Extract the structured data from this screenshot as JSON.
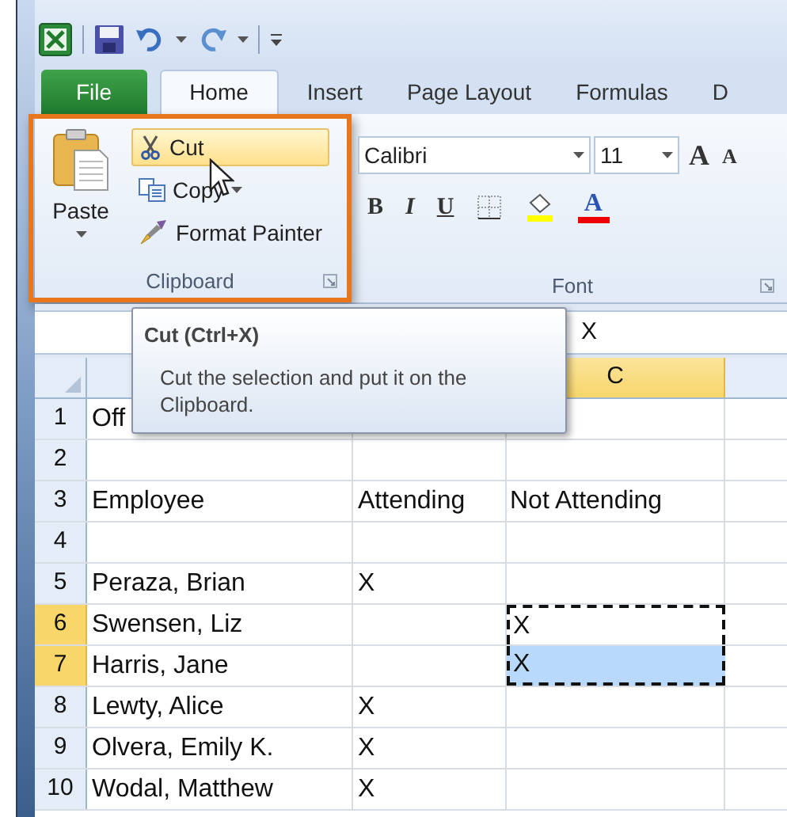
{
  "tabs": [
    {
      "label": "File",
      "kind": "file",
      "selected": false
    },
    {
      "label": "Home",
      "kind": "tab",
      "selected": true
    },
    {
      "label": "Insert",
      "kind": "tab",
      "selected": false
    },
    {
      "label": "Page Layout",
      "kind": "tab",
      "selected": false
    },
    {
      "label": "Formulas",
      "kind": "tab",
      "selected": false
    },
    {
      "label": "D",
      "kind": "tab",
      "selected": false
    }
  ],
  "clipboard": {
    "label": "Clipboard",
    "highlighted": true,
    "paste": "Paste",
    "commands": [
      {
        "label": "Cut",
        "kind": "cut",
        "hovered": true,
        "dropdown": false
      },
      {
        "label": "Copy",
        "kind": "copy",
        "hovered": false,
        "dropdown": true
      },
      {
        "label": "Format Painter",
        "kind": "painter",
        "hovered": false,
        "dropdown": false
      }
    ]
  },
  "font": {
    "label": "Font",
    "name": "Calibri",
    "size": "11",
    "grow": "A",
    "shrink": "A",
    "bold": "B",
    "italic": "I",
    "underline": "U",
    "font_color": "A"
  },
  "formula_bar": {
    "value": "X"
  },
  "tooltip": {
    "title": "Cut (Ctrl+X)",
    "text": "Cut the selection and put it on the Clipboard."
  },
  "columns": [
    {
      "label": "C",
      "selected": true
    }
  ],
  "rows": [
    {
      "number": "1",
      "selected": false,
      "a": "Off",
      "in_cut_range": false,
      "highlighted": false
    },
    {
      "number": "2",
      "selected": false,
      "in_cut_range": false,
      "highlighted": false
    },
    {
      "number": "3",
      "selected": false,
      "a": "Employee",
      "b": "Attending",
      "c": "Not Attending",
      "in_cut_range": false,
      "highlighted": false
    },
    {
      "number": "4",
      "selected": false,
      "in_cut_range": false,
      "highlighted": false
    },
    {
      "number": "5",
      "selected": false,
      "a": "Peraza, Brian",
      "b": "X",
      "in_cut_range": false,
      "highlighted": false
    },
    {
      "number": "6",
      "selected": true,
      "a": "Swensen, Liz",
      "c": "X",
      "in_cut_range": true,
      "highlighted": false
    },
    {
      "number": "7",
      "selected": true,
      "a": "Harris, Jane",
      "c": "X",
      "in_cut_range": true,
      "highlighted": true
    },
    {
      "number": "8",
      "selected": false,
      "a": "Lewty, Alice",
      "b": "X",
      "in_cut_range": false,
      "highlighted": false
    },
    {
      "number": "9",
      "selected": false,
      "a": "Olvera, Emily K.",
      "b": "X",
      "in_cut_range": false,
      "highlighted": false
    },
    {
      "number": "10",
      "selected": false,
      "a": "Wodal, Matthew",
      "b": "X",
      "in_cut_range": false,
      "highlighted": false
    }
  ]
}
